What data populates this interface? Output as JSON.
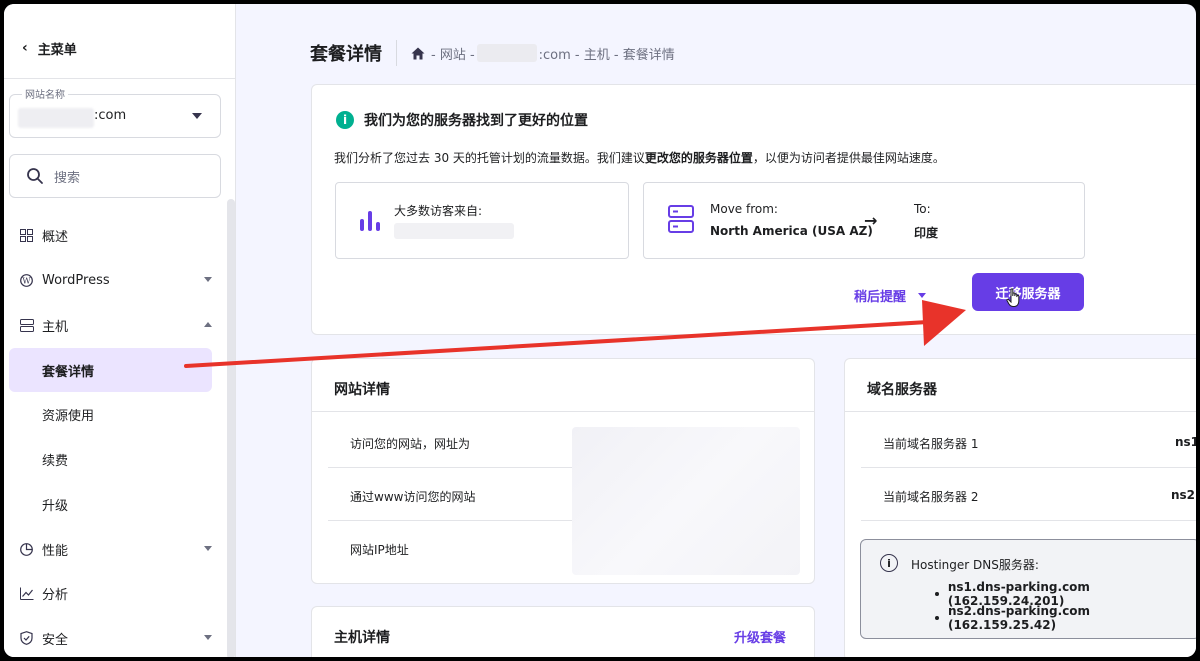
{
  "sidebar": {
    "back_label": "主菜单",
    "site_select": {
      "label": "网站名称",
      "value_suffix": ":com"
    },
    "search_placeholder": "搜索",
    "items": [
      {
        "label": "概述"
      },
      {
        "label": "WordPress"
      },
      {
        "label": "主机"
      },
      {
        "label": "套餐详情"
      },
      {
        "label": "资源使用"
      },
      {
        "label": "续费"
      },
      {
        "label": "升级"
      },
      {
        "label": "性能"
      },
      {
        "label": "分析"
      },
      {
        "label": "安全"
      }
    ]
  },
  "header": {
    "title": "套餐详情",
    "breadcrumb": {
      "part1": "- 网站 -",
      "part2": ":com - 主机 - 套餐详情"
    }
  },
  "alert": {
    "title": "我们为您的服务器找到了更好的位置",
    "desc_pre": "我们分析了您过去 30 天的托管计划的流量数据。我们建议",
    "desc_bold": "更改您的服务器位置",
    "desc_post": "，以便为访问者提供最佳网站速度。",
    "visitors_label": "大多数访客来自:",
    "move_from_label": "Move from:",
    "move_from_value": "North America (USA AZ)",
    "arrow": "→",
    "to_label": "To:",
    "to_value": "印度",
    "remind_label": "稍后提醒",
    "migrate_label": "迁移服务器"
  },
  "site_details": {
    "title": "网站详情",
    "rows": [
      "访问您的网站，网址为",
      "通过www访问您的网站",
      "网站IP地址"
    ]
  },
  "nameservers": {
    "title": "域名服务器",
    "rows": [
      {
        "label": "当前域名服务器 1",
        "value": "ns1"
      },
      {
        "label": "当前域名服务器 2",
        "value": "ns2"
      }
    ],
    "hostinger_title": "Hostinger DNS服务器:",
    "ns": [
      "ns1.dns-parking.com (162.159.24.201)",
      "ns2.dns-parking.com (162.159.25.42)"
    ]
  },
  "hosting_details": {
    "title": "主机详情",
    "upgrade_label": "升级套餐"
  },
  "colors": {
    "accent": "#673de6",
    "active_bg": "#ebe4ff",
    "info": "#00b090",
    "arrow": "#e8332a"
  }
}
